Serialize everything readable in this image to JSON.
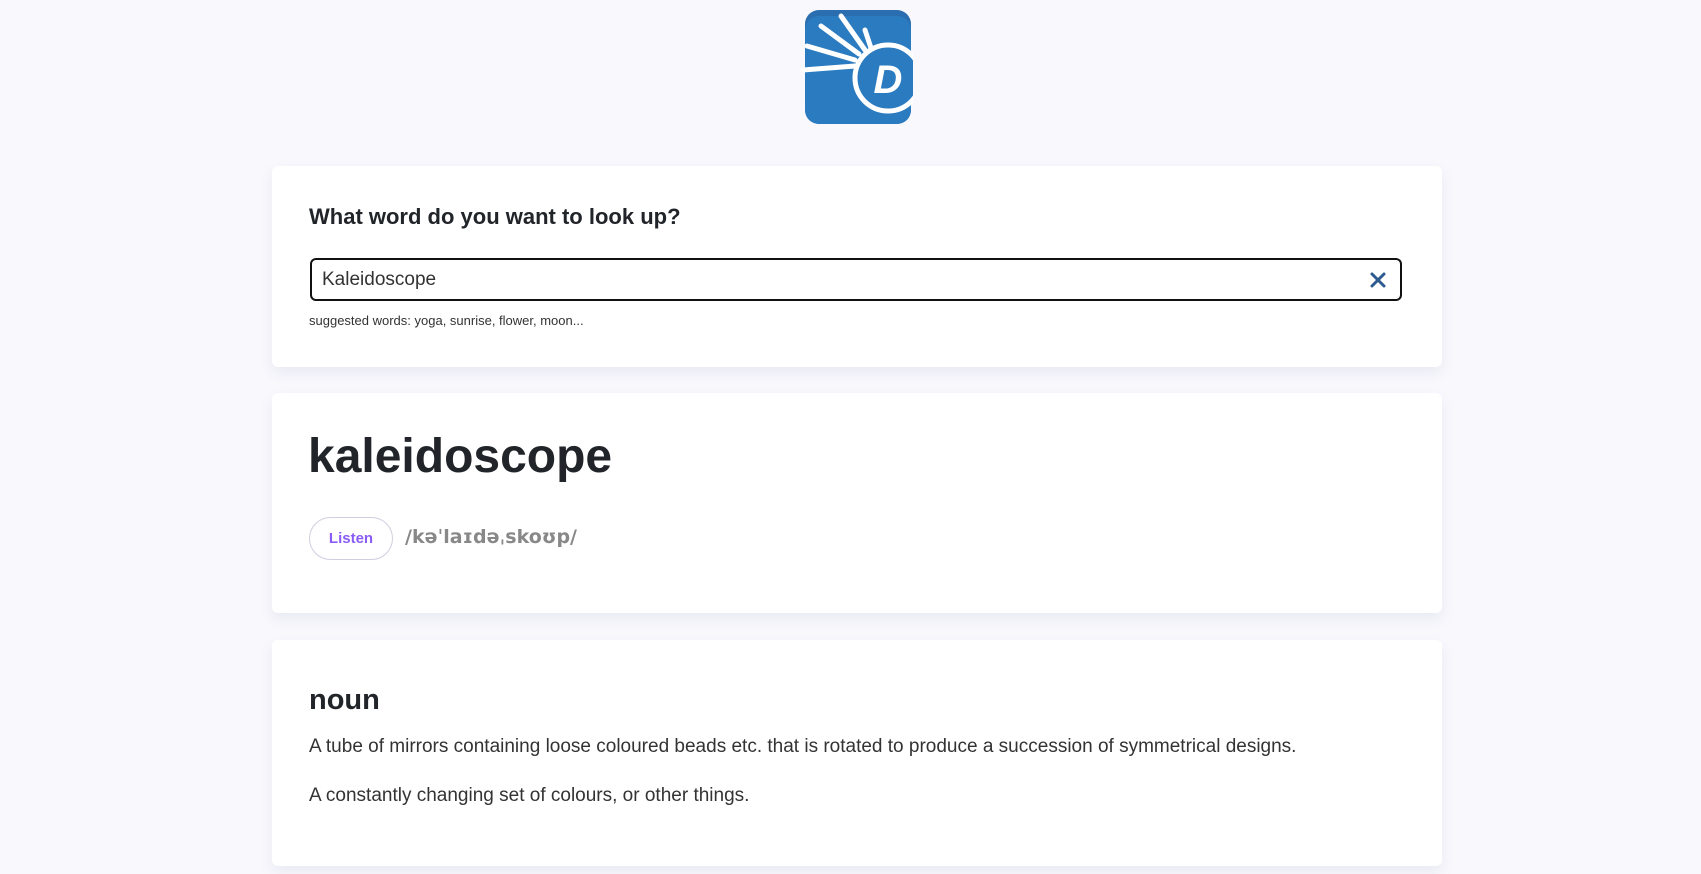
{
  "logo": {
    "letter": "D",
    "color": "#2b7bc0"
  },
  "search": {
    "heading": "What word do you want to look up?",
    "value": "Kaleidoscope",
    "clear_icon": "close-icon",
    "suggestions": "suggested words: yoga, sunrise, flower, moon..."
  },
  "word": {
    "title": "kaleidoscope",
    "listen_label": "Listen",
    "phonetic": "/kəˈlaɪdəˌskoʊp/",
    "accent_color": "#8a5cf5"
  },
  "meanings": [
    {
      "part_of_speech": "noun",
      "definitions": [
        "A tube of mirrors containing loose coloured beads etc. that is rotated to produce a succession of symmetrical designs.",
        "A constantly changing set of colours, or other things."
      ]
    }
  ]
}
